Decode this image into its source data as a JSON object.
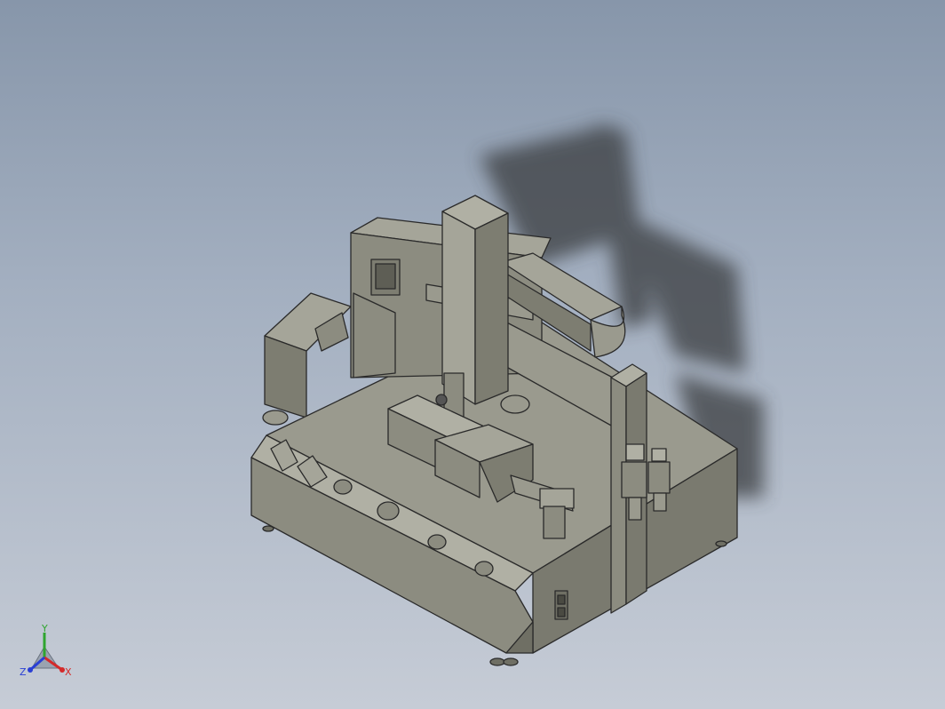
{
  "viewport": {
    "background_top": "#8796aa",
    "background_bottom": "#c6ccd6",
    "model_fill": "#8c8c80",
    "model_fill_light": "#a5a599",
    "model_fill_dark": "#6f6f64",
    "edge_color": "#2a2a2a",
    "shadow_color": "#3a3c40"
  },
  "triad": {
    "x_label": "X",
    "y_label": "Y",
    "z_label": "Z",
    "x_color": "#d42a2a",
    "y_color": "#2fa52f",
    "z_color": "#2a3fd4"
  }
}
